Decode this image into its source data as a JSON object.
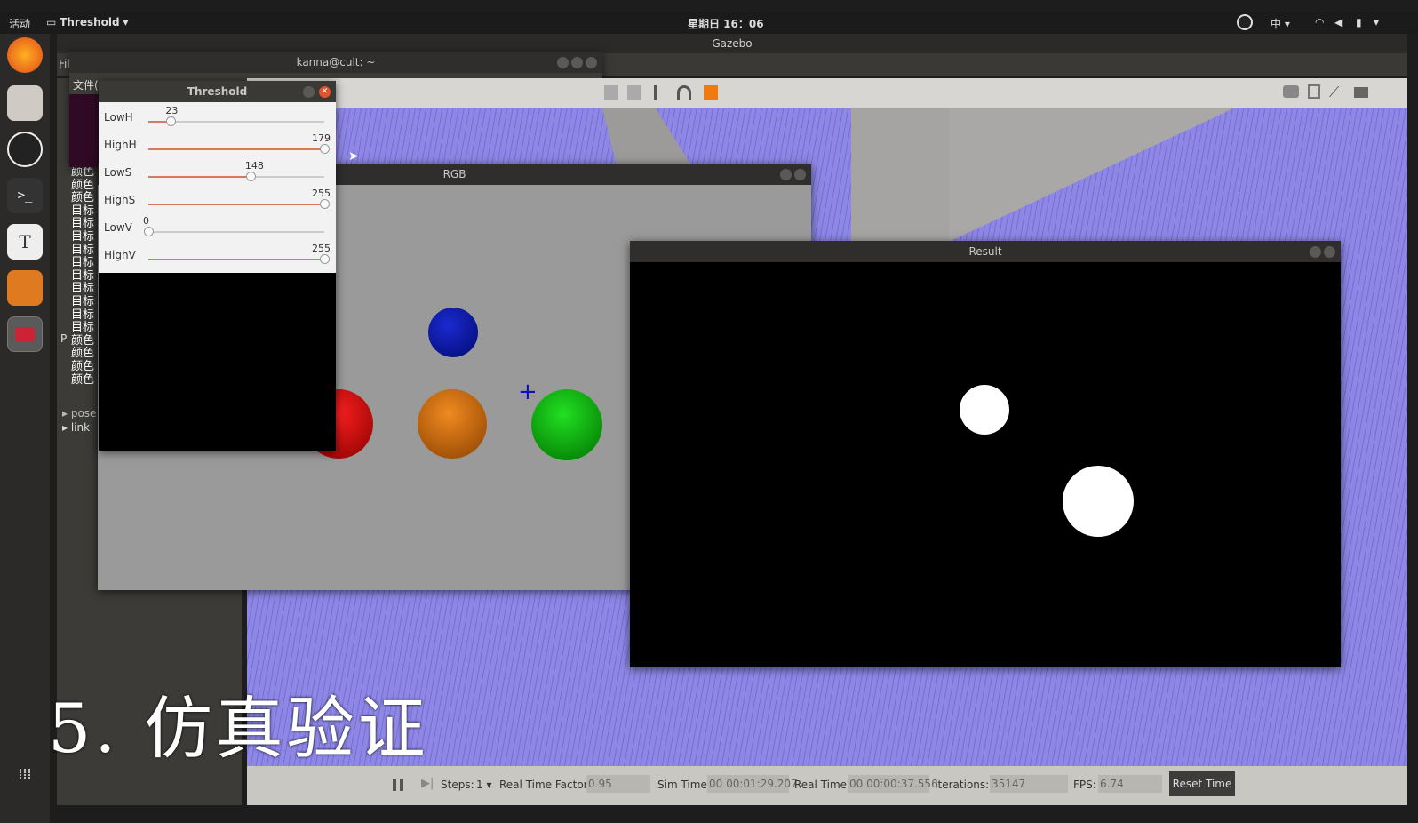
{
  "topbar": {
    "activities": "活动",
    "app_menu": "Threshold",
    "clock": "星期日 16：06",
    "input_method": "中"
  },
  "gazebo": {
    "title": "Gazebo",
    "menu_file": "Fil"
  },
  "terminal": {
    "title": "kanna@cult: ~",
    "menu_file": "文件("
  },
  "left_panel": {
    "lines": [
      "颜色",
      "颜色",
      "颜色",
      "颜色",
      "颜色",
      "颜色",
      "颜色",
      "颜色",
      "目标",
      "目标",
      "目标",
      "目标",
      "目标",
      "目标",
      "目标",
      "目标",
      "目标",
      "目标",
      "颜色",
      "颜色",
      "颜色",
      "颜色"
    ],
    "tree_items": [
      "pose",
      "link"
    ],
    "p_label": "P"
  },
  "threshold_window": {
    "title": "Threshold",
    "sliders": [
      {
        "label": "LowH",
        "value": "23",
        "fraction": 0.128
      },
      {
        "label": "HighH",
        "value": "179",
        "fraction": 1.0
      },
      {
        "label": "LowS",
        "value": "148",
        "fraction": 0.58
      },
      {
        "label": "HighS",
        "value": "255",
        "fraction": 1.0
      },
      {
        "label": "LowV",
        "value": "0",
        "fraction": 0.0
      },
      {
        "label": "HighV",
        "value": "255",
        "fraction": 1.0
      }
    ]
  },
  "rgb_window": {
    "title": "RGB"
  },
  "result_window": {
    "title": "Result"
  },
  "sim_bar": {
    "steps_label": "Steps:",
    "steps_value": "1",
    "rtf_label": "Real Time Factor:",
    "rtf_value": "0.95",
    "sim_time_label": "Sim Time:",
    "sim_time_value": "00 00:01:29.207",
    "real_time_label": "Real Time:",
    "real_time_value": "00 00:00:37.556",
    "iterations_label": "Iterations:",
    "iterations_value": "35147",
    "fps_label": "FPS:",
    "fps_value": "6.74",
    "reset_label": "Reset Time"
  },
  "caption": "5. 仿真验证",
  "colors": {
    "red_ball": "#d00000",
    "orange_ball": "#d06a00",
    "green_ball": "#00b000",
    "blue_ball": "#0010a0",
    "slider_fill": "#d87a5a",
    "close_button": "#e0552d"
  }
}
